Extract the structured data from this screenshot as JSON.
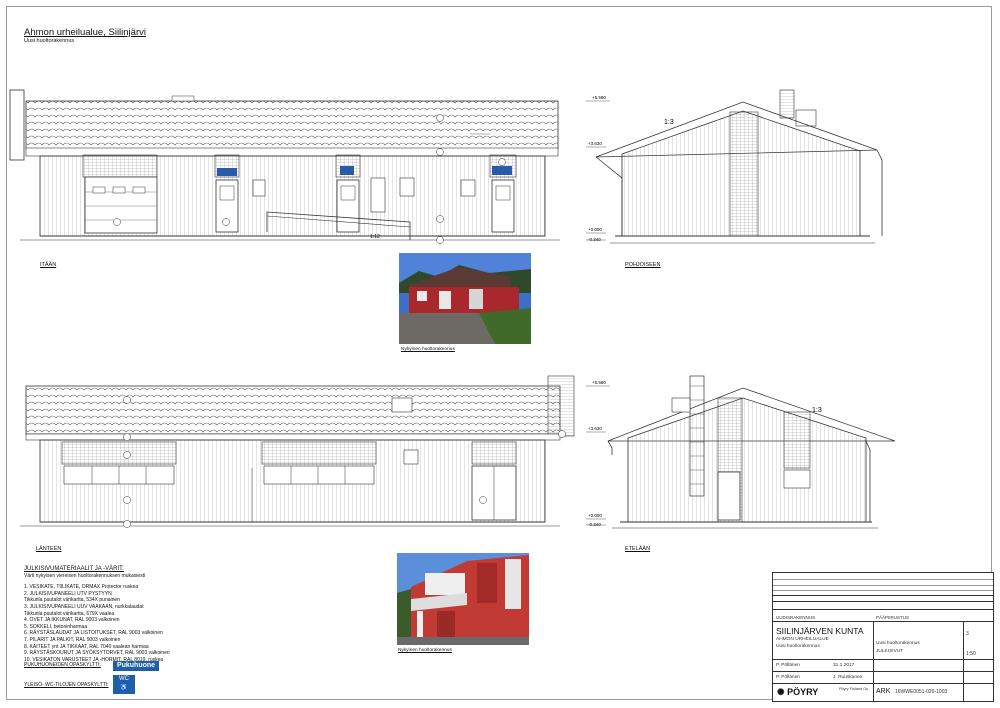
{
  "sheet": {
    "title": "Ahmon urheilualue, Siilinjärvi",
    "subtitle": "Uusi huoltorakennus"
  },
  "views": {
    "east": "ITÄÄN",
    "north": "POHJOISEEN",
    "west": "LÄNTEEN",
    "south": "ETELÄÄN"
  },
  "levels": {
    "top": "+5.580",
    "eave": "+3.630",
    "zero": "+0.000",
    "ground": "-0.340"
  },
  "roof": {
    "slope": "1:3",
    "slope_ramp": "1:12"
  },
  "photos": {
    "caption1": "Nykyinen huoltorakennus",
    "caption2": "Nykyinen huoltorakennus"
  },
  "materials": {
    "heading": "JULKISIVUMATERIAALIT JA -VÄRIT:",
    "intro": "Värit nykyisen viereisen huoltorakennuksen mukaisesti",
    "items": [
      "1. VESIKATE, TIILIKATE, ORMAX Protector ruskea",
      "2. JULKISIVUPANEELI UTV PYSTYYN",
      "   Tikkurila puutalot värikartta, 534X punainen",
      "3. JULKISIVUPANEELI UUV VAAKAAN, nurkkalaudat",
      "   Tikkurila puutalot värikartta, 679X vaalea",
      "4. OVET JA IKKUNAT, RAL 9003 valkoinen",
      "5. SOKKELI, betoninharmaa",
      "6. RÄYSTÄSLAUDAT JA LISTOITUKSET, RAL 9003 valkoinen",
      "7. PILARIT JA PALKIT, RAL 9003 valkoinen",
      "8. KAITEET ynt JA TIKKAAT, RAL 7040 vaalean harmaa",
      "9. RÄYSTÄSKOURUT JA SYÖKSYTORVET, RAL 9003 valkoinen",
      "10. VESIKATON VARUSTEET JA -HORMIT, RAL 8019, ruskea"
    ],
    "sign_label": "PUKUHUONEIDEN OPASKYLTTI:",
    "sign_text": "Pukuhuone",
    "wc_label": "YLEISÖ- WC-TILOJEN OPASKYLTTI:",
    "wc_text": "WC"
  },
  "titleblock": {
    "client": "SIILINJÄRVEN KUNTA",
    "project": "AHMON URHEILUALUE",
    "building": "Uusi huoltorakennus",
    "drawing": "JULKISIVUT",
    "design_type": "PÄÄPIIRUSTUS",
    "content": "Uusi huoltorakennus",
    "drawer": "P. Pöllänen",
    "designer": "P. Pöllänen",
    "checker": "J. Ruuskanen",
    "date": "31.1.2017",
    "scale": "1:50",
    "discipline": "ARK",
    "drawing_no": "16WWE0051-020-1003",
    "revision": "3",
    "company": "PÖYRY",
    "company_full": "Pöyry Finland Oy",
    "new_building": "UUDISRAKENNUS"
  }
}
